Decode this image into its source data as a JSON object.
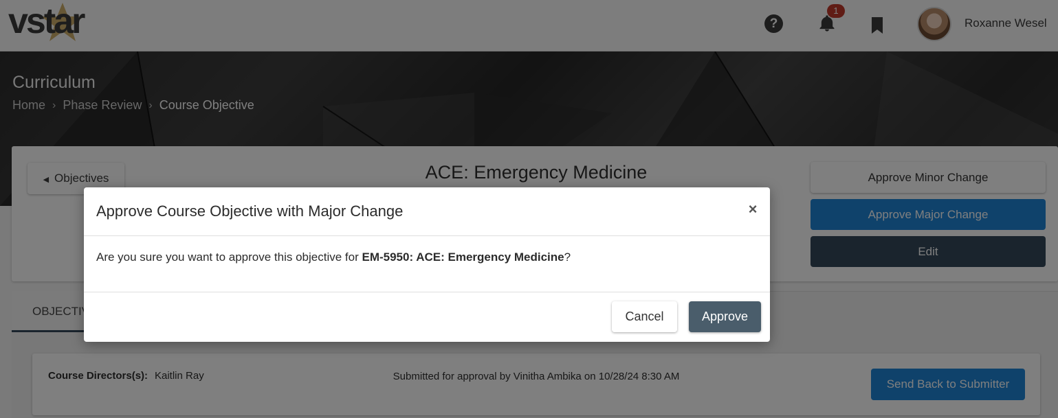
{
  "header": {
    "logo_text": "vstar",
    "notification_count": "1",
    "user_name": "Roxanne Wesel",
    "help_glyph": "?"
  },
  "hero": {
    "title": "Curriculum",
    "breadcrumbs": [
      "Home",
      "Phase Review",
      "Course Objective"
    ]
  },
  "course": {
    "back_label": "Objectives",
    "title": "ACE: Emergency Medicine",
    "actions": {
      "approve_minor": "Approve Minor Change",
      "approve_major": "Approve Major Change",
      "edit": "Edit"
    }
  },
  "tabs": {
    "active_label": "OBJECTIV"
  },
  "info": {
    "directors_label": "Course Directors(s):",
    "directors_value": "Kaitlin Ray",
    "submitted_text": "Submitted for approval by Vinitha Ambika on 10/28/24 8:30 AM",
    "send_back_label": "Send Back to Submitter"
  },
  "modal": {
    "title": "Approve Course Objective with Major Change",
    "close_glyph": "×",
    "body_prefix": "Are you sure you want to approve this objective for ",
    "body_course": "EM-5950: ACE: Emergency Medicine",
    "body_suffix": "?",
    "cancel_label": "Cancel",
    "approve_label": "Approve"
  },
  "colors": {
    "primary_blue": "#1f84d6",
    "dark_slate": "#34495a",
    "badge_red": "#c0392b",
    "logo_star": "#c9a55a"
  },
  "icons": [
    "help-icon",
    "bell-icon",
    "bookmark-icon",
    "caret-left-icon",
    "chevron-right-icon",
    "close-icon"
  ]
}
